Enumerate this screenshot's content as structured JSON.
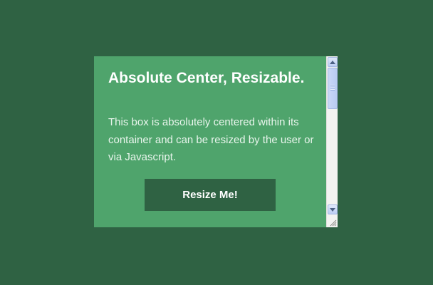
{
  "box": {
    "title": "Absolute Center, Resizable.",
    "description": "This box is absolutely centered within its container and can be resized by the user or via Javascript.",
    "button_label": "Resize Me!"
  },
  "scrollbar": {
    "up_icon": "arrow-up-icon",
    "down_icon": "arrow-down-icon",
    "position": 0.0
  },
  "icons": {
    "resize_grip": "resize-grip-icon"
  },
  "colors": {
    "page_background": "#2f6243",
    "box_background": "#4fa46c",
    "button_background": "#2f6243",
    "text": "#ffffff"
  }
}
